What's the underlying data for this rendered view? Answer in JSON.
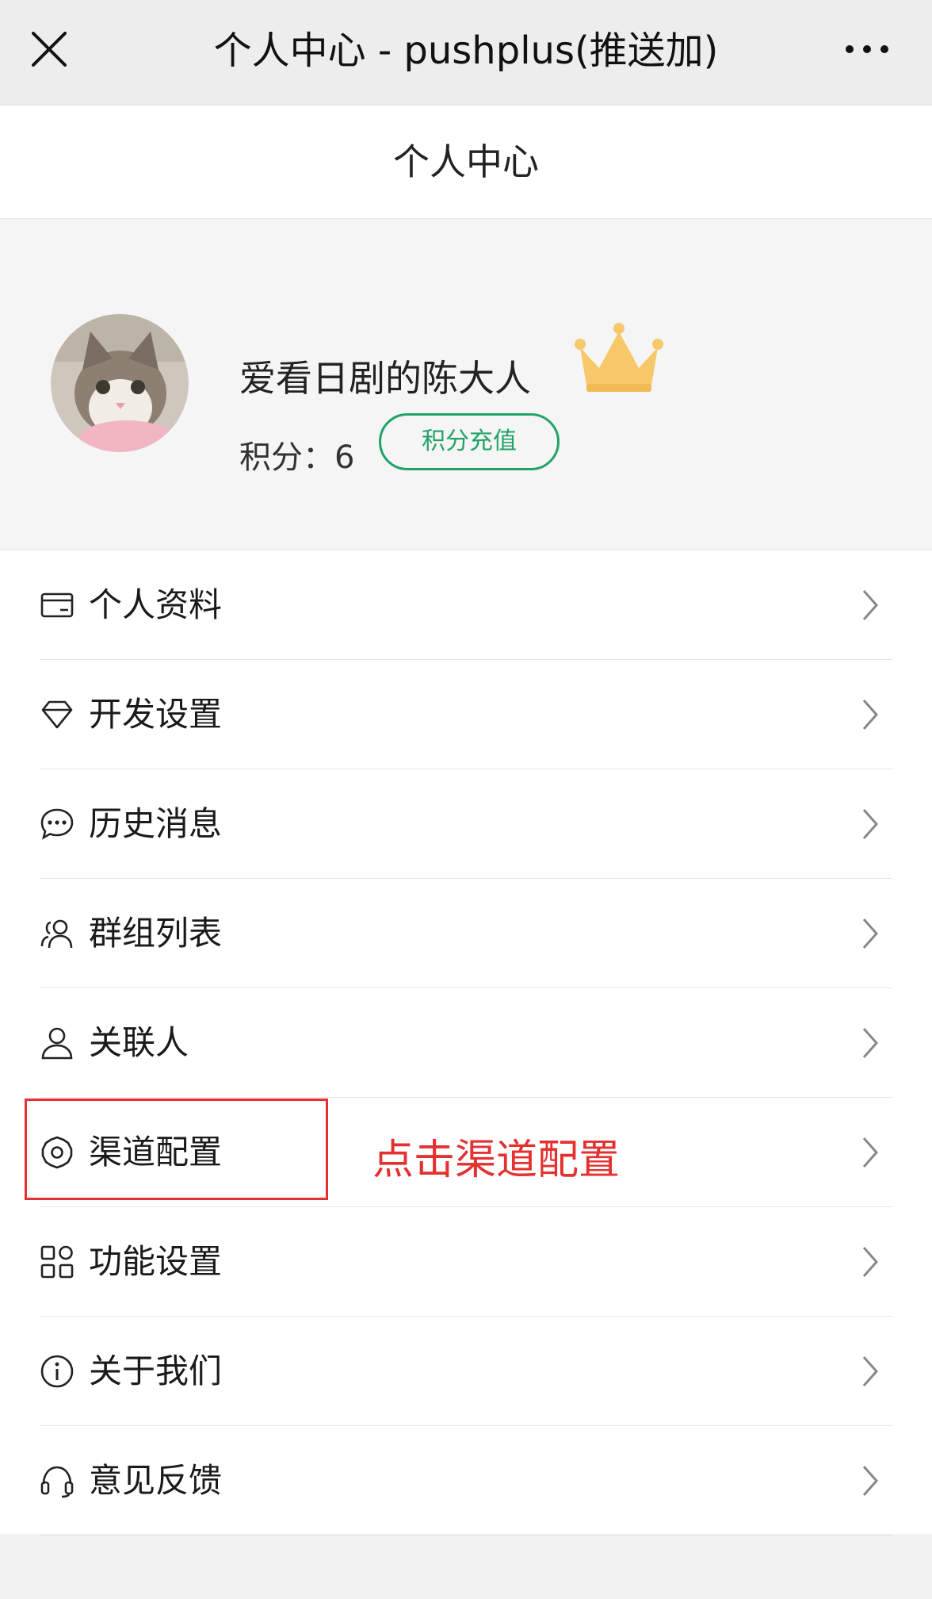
{
  "app": {
    "window_title": "个人中心 - pushplus(推送加)",
    "page_title": "个人中心"
  },
  "profile": {
    "nickname": "爱看日剧的陈大人",
    "points_label": "积分：",
    "points_value": "6",
    "recharge_label": "积分充值",
    "vip_icon": "crown-icon"
  },
  "menu": {
    "items": [
      {
        "label": "个人资料",
        "icon": "id-card-icon"
      },
      {
        "label": "开发设置",
        "icon": "diamond-icon"
      },
      {
        "label": "历史消息",
        "icon": "chat-bubble-icon"
      },
      {
        "label": "群组列表",
        "icon": "group-icon"
      },
      {
        "label": "关联人",
        "icon": "user-icon"
      },
      {
        "label": "渠道配置",
        "icon": "gear-icon"
      },
      {
        "label": "功能设置",
        "icon": "grid-icon"
      },
      {
        "label": "关于我们",
        "icon": "info-icon"
      },
      {
        "label": "意见反馈",
        "icon": "headset-icon"
      }
    ]
  },
  "annotation": {
    "text": "点击渠道配置",
    "color": "#e53030"
  },
  "colors": {
    "accent": "#21a366",
    "crown": "#f6c86a",
    "topbar": "#ededed"
  }
}
